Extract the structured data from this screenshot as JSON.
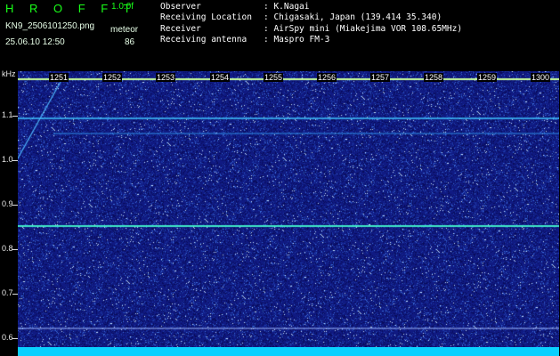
{
  "header": {
    "brand": "H R O F F T",
    "speed": "1.0.0f",
    "filename": "KN9_2506101250.png",
    "datetime": "25.06.10 12:50",
    "meteor_label": "meteor",
    "meteor_count": "86",
    "info": [
      {
        "key": "Observer",
        "value": ": K.Nagai"
      },
      {
        "key": "Receiving Location",
        "value": ": Chigasaki, Japan (139.414 35.340)"
      },
      {
        "key": "Receiver",
        "value": ": AirSpy mini (Miakejima VOR 108.65MHz)"
      },
      {
        "key": "Receiving antenna",
        "value": ": Maspro FM-3"
      }
    ]
  },
  "yaxis": {
    "unit": "kHz",
    "labels": [
      "1.1",
      "1.0",
      "0.9",
      "0.8",
      "0.7",
      "0.6"
    ]
  },
  "minute_labels": [
    "1251",
    "1252",
    "1253",
    "1254",
    "1255",
    "1256",
    "1257",
    "1258",
    "1259",
    "1300"
  ],
  "colors": {
    "background": "#000000",
    "waterfall": "#101a82",
    "signal": "#2fe0c0",
    "header_green": "#19ff19"
  }
}
